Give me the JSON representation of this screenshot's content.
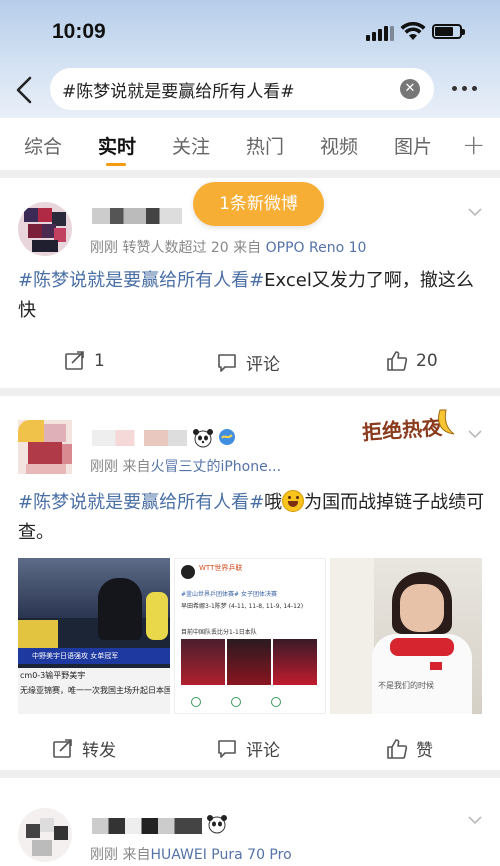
{
  "status": {
    "time": "10:09"
  },
  "search": {
    "query": "#陈梦说就是要赢给所有人看#"
  },
  "tabs": [
    "综合",
    "实时",
    "关注",
    "热门",
    "视频",
    "图片"
  ],
  "new_posts_pill": "1条新微博",
  "posts": [
    {
      "meta_prefix": "刚刚 转赞人数超过 20 来自 ",
      "meta_source": "OPPO Reno 10",
      "hashtag": "#陈梦说就是要赢给所有人看#",
      "text": "Excel又发力了啊，撤这么快",
      "repost": "1",
      "comment": "评论",
      "like": "20"
    },
    {
      "meta_prefix": "刚刚 来自",
      "meta_source": "火冒三丈的iPhone...",
      "hashtag": "#陈梦说就是要赢给所有人看#",
      "text_a": "哦",
      "text_b": "为国而战掉链子战绩可查。",
      "sticker": "拒绝热夜",
      "images": {
        "img1_lines": [
          "中野美宇日语强攻 女单冠军",
          "cm0-3输平野美宇",
          "无缘亚锦赛，唯一一次我国主场升起日本国"
        ],
        "img2_lines": [
          "WTT世界乒联",
          "#釜山世界乒团体赛# 女子团体决赛",
          "早田希娜3-1陈梦 (4-11, 11-8, 11-9, 14-12)",
          "目前中国队丢比分1-1日本队"
        ],
        "img3_caption": "不是我们的时候"
      },
      "repost": "转发",
      "comment": "评论",
      "like": "赞"
    },
    {
      "meta_prefix": "刚刚 来自",
      "meta_source": "HUAWEI Pura 70 Pro"
    }
  ],
  "colors": {
    "accent": "#f39c12",
    "link": "#4a6fa5",
    "pill": "#f6ae35"
  }
}
